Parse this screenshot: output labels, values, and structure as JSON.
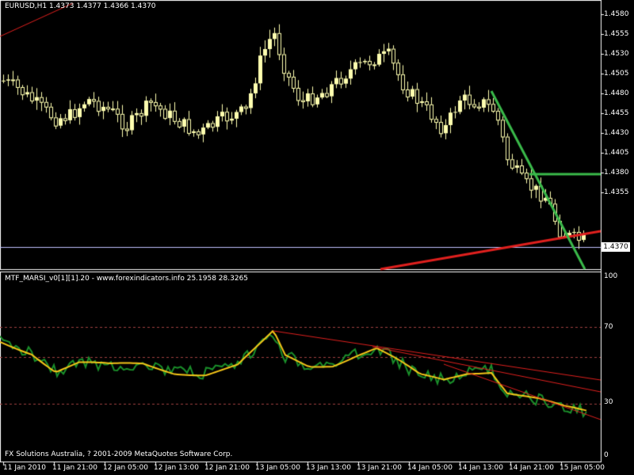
{
  "main_chart": {
    "header": "EURUSD,H1  1.4373 1.4377 1.4366 1.4370",
    "current_price": "1.4370",
    "price_labels": [
      "1.4580",
      "1.4555",
      "1.4530",
      "1.4505",
      "1.4480",
      "1.4455",
      "1.4430",
      "1.4405",
      "1.4380",
      "1.4355"
    ],
    "colors": {
      "background": "#000000",
      "candle": "#ffffb0",
      "grid": "#ffffff",
      "trend_red": "#e0201e",
      "trend_green": "#3ab94a",
      "price_line": "#c0c0ff"
    }
  },
  "indicator": {
    "header": "MTF_MARSI_v0[1][1].20 - www.forexindicators.info 25.1958 28.3265",
    "level_labels": [
      "100",
      "70",
      "30",
      "0"
    ],
    "colors": {
      "fast": "#1a8f2a",
      "slow": "#f5c518",
      "levels": "#a04040",
      "trend": "#e0201e"
    }
  },
  "time_labels": [
    "11 Jan 2010",
    "11 Jan 21:00",
    "12 Jan 05:00",
    "12 Jan 13:00",
    "12 Jan 21:00",
    "13 Jan 05:00",
    "13 Jan 13:00",
    "13 Jan 21:00",
    "14 Jan 05:00",
    "14 Jan 13:00",
    "14 Jan 21:00",
    "15 Jan 05:00"
  ],
  "copyright": "FX Solutions Australia, ? 2001-2009 MetaQuotes Software Corp."
}
